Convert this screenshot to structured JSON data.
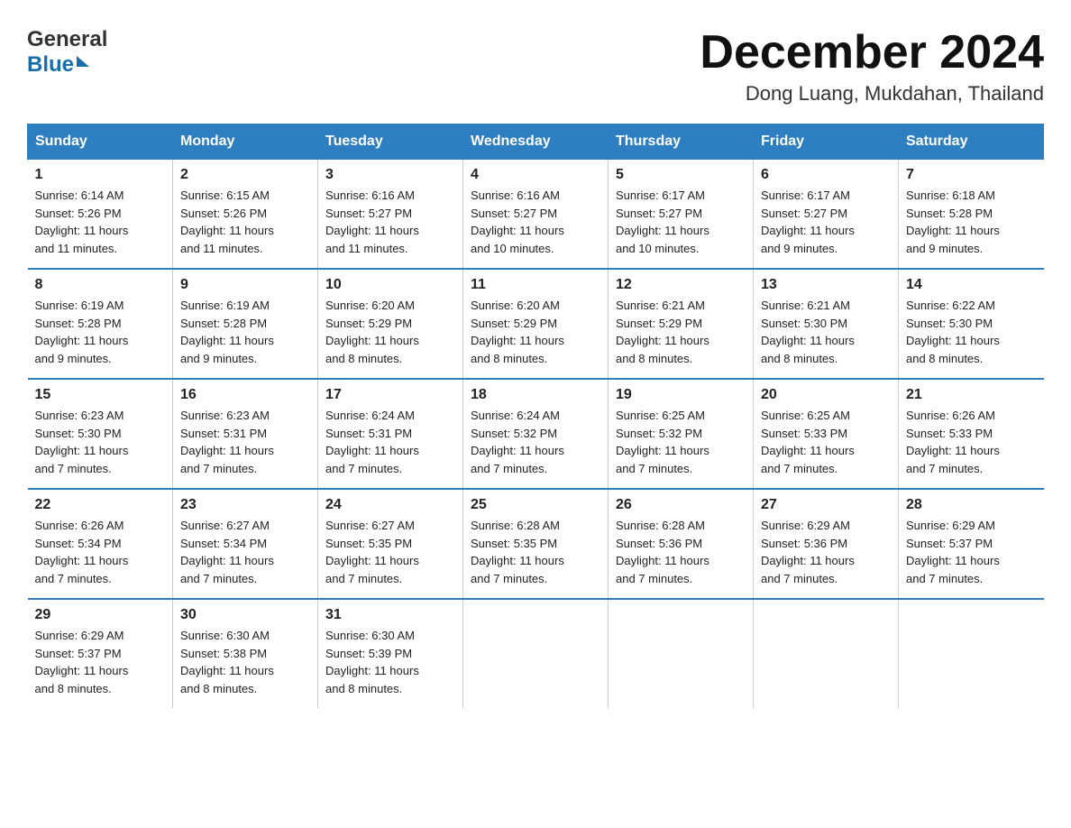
{
  "header": {
    "logo_general": "General",
    "logo_blue": "Blue",
    "month_year": "December 2024",
    "location": "Dong Luang, Mukdahan, Thailand"
  },
  "days_of_week": [
    "Sunday",
    "Monday",
    "Tuesday",
    "Wednesday",
    "Thursday",
    "Friday",
    "Saturday"
  ],
  "weeks": [
    [
      {
        "day": "1",
        "sunrise": "6:14 AM",
        "sunset": "5:26 PM",
        "daylight": "11 hours and 11 minutes."
      },
      {
        "day": "2",
        "sunrise": "6:15 AM",
        "sunset": "5:26 PM",
        "daylight": "11 hours and 11 minutes."
      },
      {
        "day": "3",
        "sunrise": "6:16 AM",
        "sunset": "5:27 PM",
        "daylight": "11 hours and 11 minutes."
      },
      {
        "day": "4",
        "sunrise": "6:16 AM",
        "sunset": "5:27 PM",
        "daylight": "11 hours and 10 minutes."
      },
      {
        "day": "5",
        "sunrise": "6:17 AM",
        "sunset": "5:27 PM",
        "daylight": "11 hours and 10 minutes."
      },
      {
        "day": "6",
        "sunrise": "6:17 AM",
        "sunset": "5:27 PM",
        "daylight": "11 hours and 9 minutes."
      },
      {
        "day": "7",
        "sunrise": "6:18 AM",
        "sunset": "5:28 PM",
        "daylight": "11 hours and 9 minutes."
      }
    ],
    [
      {
        "day": "8",
        "sunrise": "6:19 AM",
        "sunset": "5:28 PM",
        "daylight": "11 hours and 9 minutes."
      },
      {
        "day": "9",
        "sunrise": "6:19 AM",
        "sunset": "5:28 PM",
        "daylight": "11 hours and 9 minutes."
      },
      {
        "day": "10",
        "sunrise": "6:20 AM",
        "sunset": "5:29 PM",
        "daylight": "11 hours and 8 minutes."
      },
      {
        "day": "11",
        "sunrise": "6:20 AM",
        "sunset": "5:29 PM",
        "daylight": "11 hours and 8 minutes."
      },
      {
        "day": "12",
        "sunrise": "6:21 AM",
        "sunset": "5:29 PM",
        "daylight": "11 hours and 8 minutes."
      },
      {
        "day": "13",
        "sunrise": "6:21 AM",
        "sunset": "5:30 PM",
        "daylight": "11 hours and 8 minutes."
      },
      {
        "day": "14",
        "sunrise": "6:22 AM",
        "sunset": "5:30 PM",
        "daylight": "11 hours and 8 minutes."
      }
    ],
    [
      {
        "day": "15",
        "sunrise": "6:23 AM",
        "sunset": "5:30 PM",
        "daylight": "11 hours and 7 minutes."
      },
      {
        "day": "16",
        "sunrise": "6:23 AM",
        "sunset": "5:31 PM",
        "daylight": "11 hours and 7 minutes."
      },
      {
        "day": "17",
        "sunrise": "6:24 AM",
        "sunset": "5:31 PM",
        "daylight": "11 hours and 7 minutes."
      },
      {
        "day": "18",
        "sunrise": "6:24 AM",
        "sunset": "5:32 PM",
        "daylight": "11 hours and 7 minutes."
      },
      {
        "day": "19",
        "sunrise": "6:25 AM",
        "sunset": "5:32 PM",
        "daylight": "11 hours and 7 minutes."
      },
      {
        "day": "20",
        "sunrise": "6:25 AM",
        "sunset": "5:33 PM",
        "daylight": "11 hours and 7 minutes."
      },
      {
        "day": "21",
        "sunrise": "6:26 AM",
        "sunset": "5:33 PM",
        "daylight": "11 hours and 7 minutes."
      }
    ],
    [
      {
        "day": "22",
        "sunrise": "6:26 AM",
        "sunset": "5:34 PM",
        "daylight": "11 hours and 7 minutes."
      },
      {
        "day": "23",
        "sunrise": "6:27 AM",
        "sunset": "5:34 PM",
        "daylight": "11 hours and 7 minutes."
      },
      {
        "day": "24",
        "sunrise": "6:27 AM",
        "sunset": "5:35 PM",
        "daylight": "11 hours and 7 minutes."
      },
      {
        "day": "25",
        "sunrise": "6:28 AM",
        "sunset": "5:35 PM",
        "daylight": "11 hours and 7 minutes."
      },
      {
        "day": "26",
        "sunrise": "6:28 AM",
        "sunset": "5:36 PM",
        "daylight": "11 hours and 7 minutes."
      },
      {
        "day": "27",
        "sunrise": "6:29 AM",
        "sunset": "5:36 PM",
        "daylight": "11 hours and 7 minutes."
      },
      {
        "day": "28",
        "sunrise": "6:29 AM",
        "sunset": "5:37 PM",
        "daylight": "11 hours and 7 minutes."
      }
    ],
    [
      {
        "day": "29",
        "sunrise": "6:29 AM",
        "sunset": "5:37 PM",
        "daylight": "11 hours and 8 minutes."
      },
      {
        "day": "30",
        "sunrise": "6:30 AM",
        "sunset": "5:38 PM",
        "daylight": "11 hours and 8 minutes."
      },
      {
        "day": "31",
        "sunrise": "6:30 AM",
        "sunset": "5:39 PM",
        "daylight": "11 hours and 8 minutes."
      },
      null,
      null,
      null,
      null
    ]
  ],
  "labels": {
    "sunrise": "Sunrise:",
    "sunset": "Sunset:",
    "daylight": "Daylight:"
  }
}
